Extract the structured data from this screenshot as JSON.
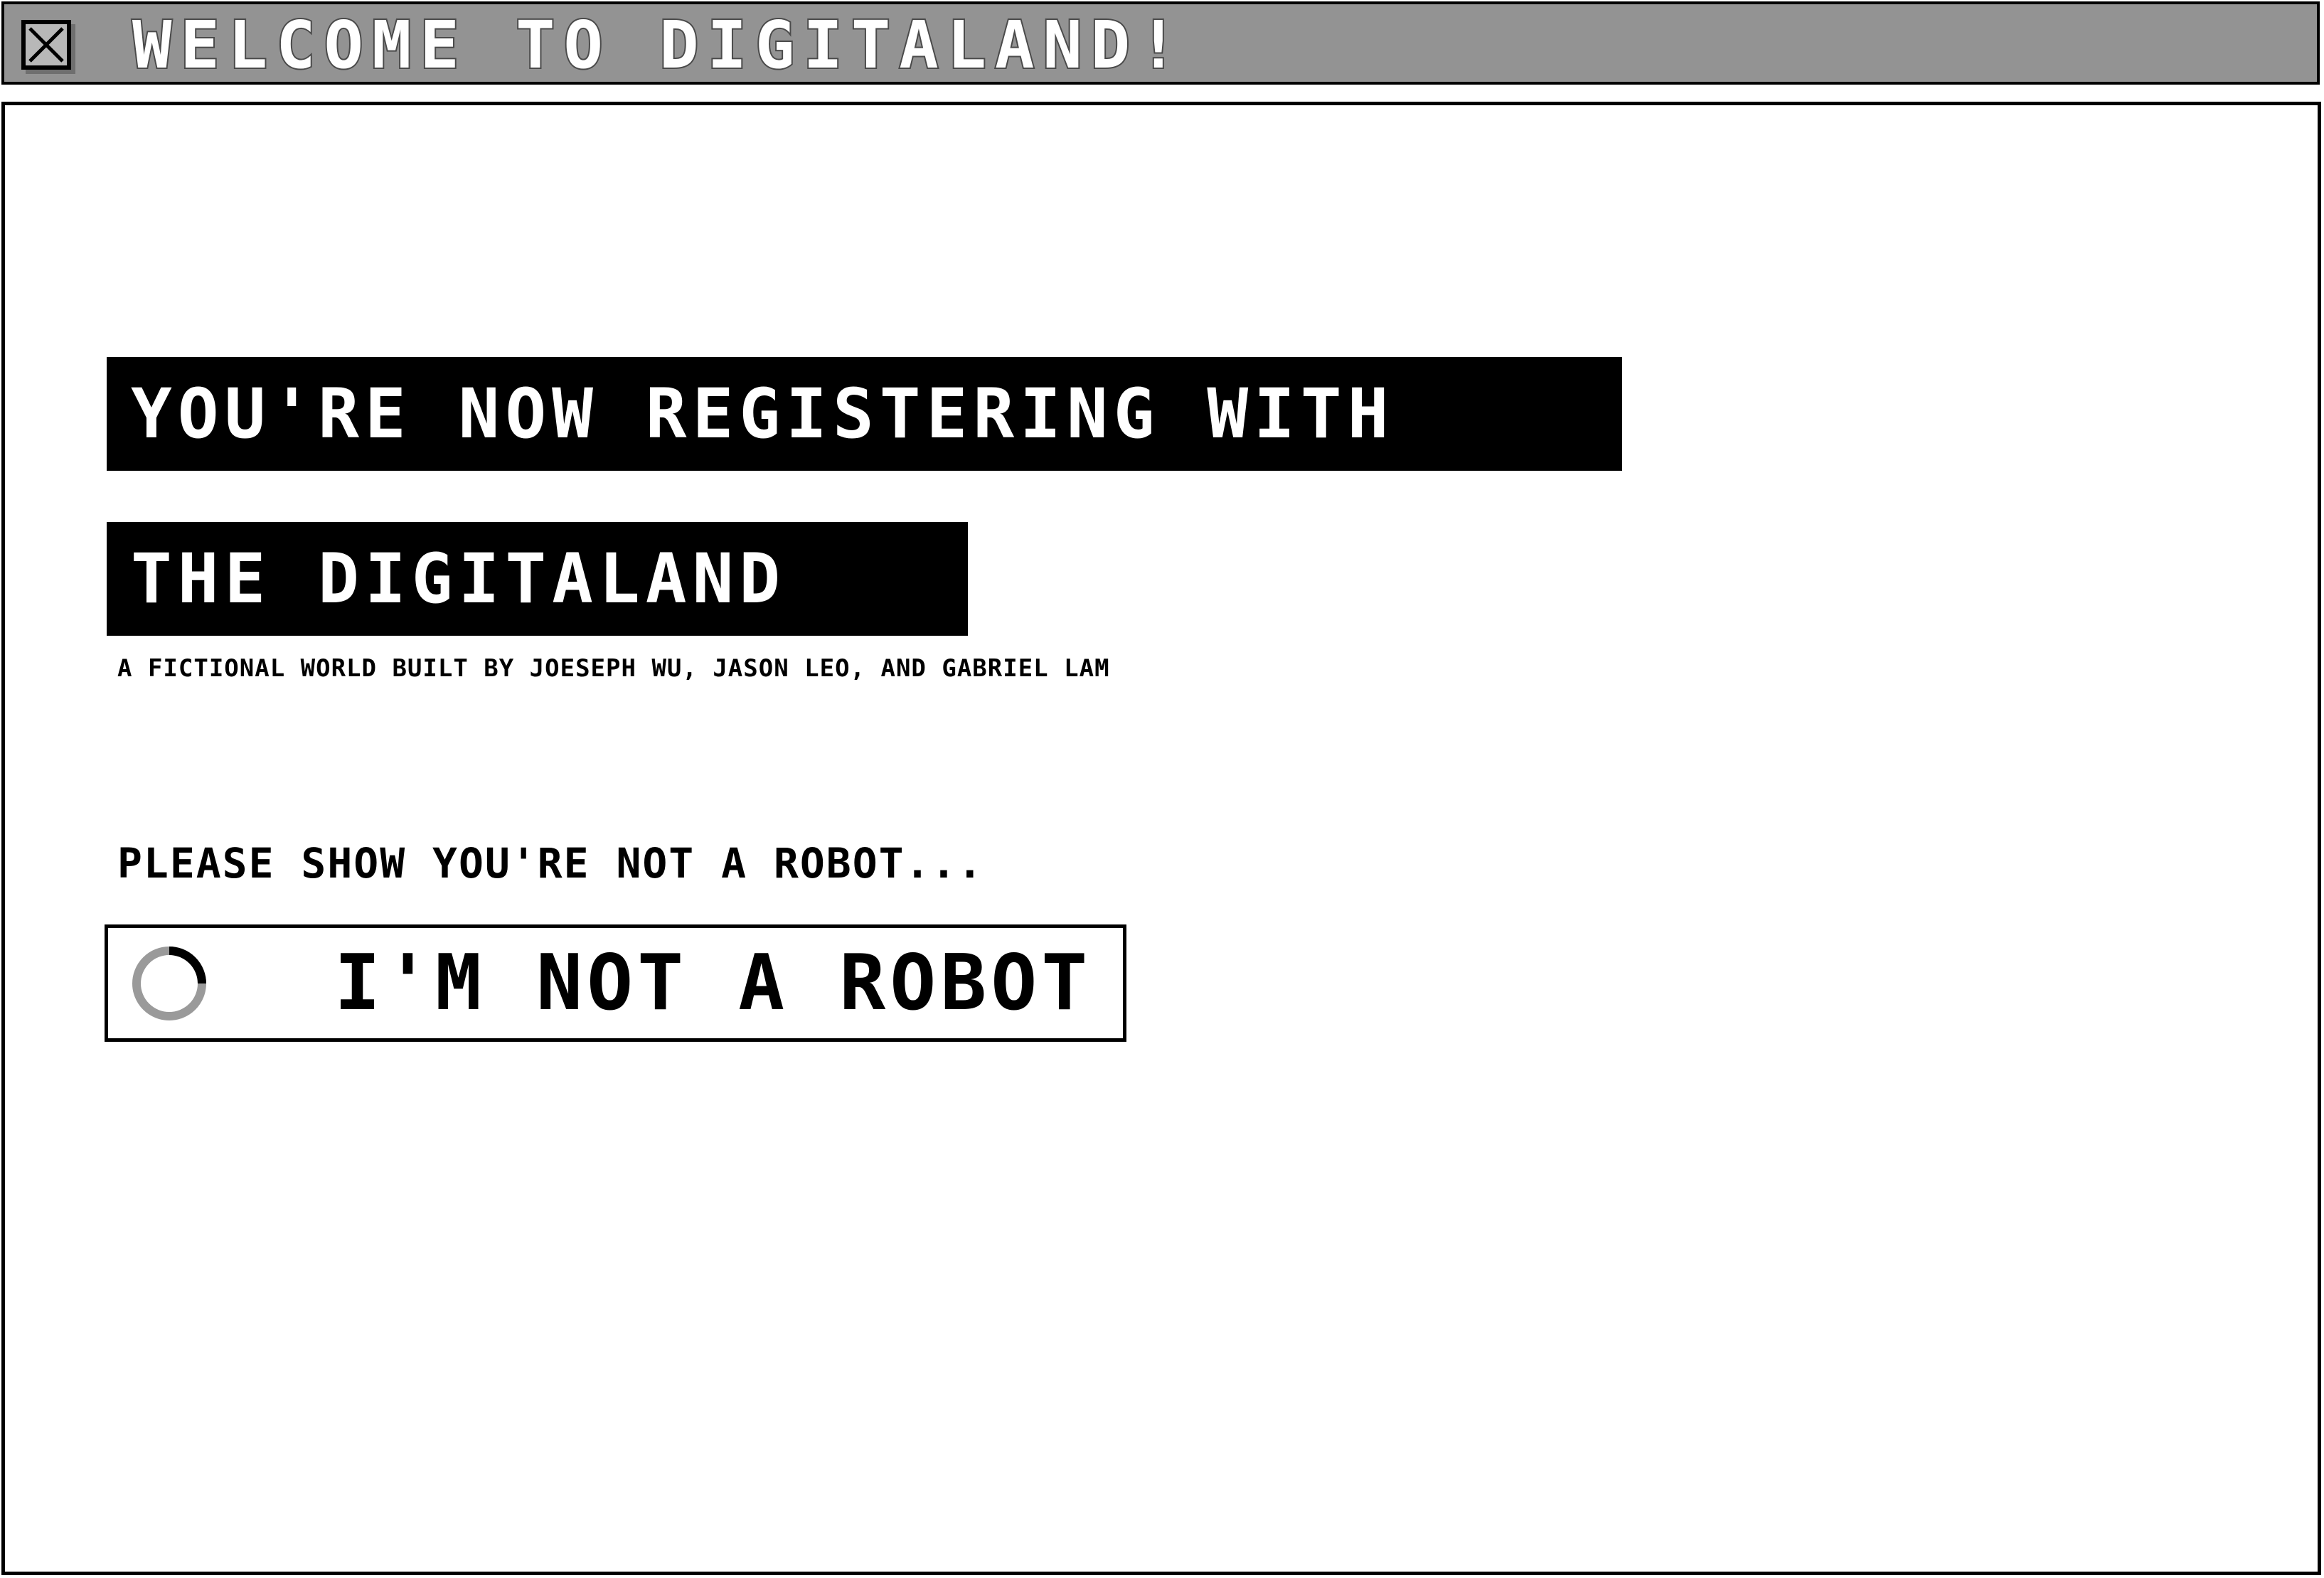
{
  "window": {
    "title": "WELCOME TO DIGITALAND!",
    "close_icon": "close-box-icon"
  },
  "main": {
    "heading_line_1": "YOU'RE NOW REGISTERING WITH",
    "heading_line_2": "THE DIGITALAND",
    "credits": "A FICTIONAL WORLD BUILT BY JOESEPH WU, JASON LEO, AND GABRIEL LAM",
    "captcha_prompt": "PLEASE SHOW YOU'RE NOT A ROBOT...",
    "captcha_button_label": "I'M NOT A ROBOT",
    "captcha_icon": "loading-spinner-icon"
  },
  "colors": {
    "titlebar": "#939393",
    "banner": "#000000",
    "spinner_track": "#9a9a9a",
    "spinner_arc": "#000000"
  }
}
